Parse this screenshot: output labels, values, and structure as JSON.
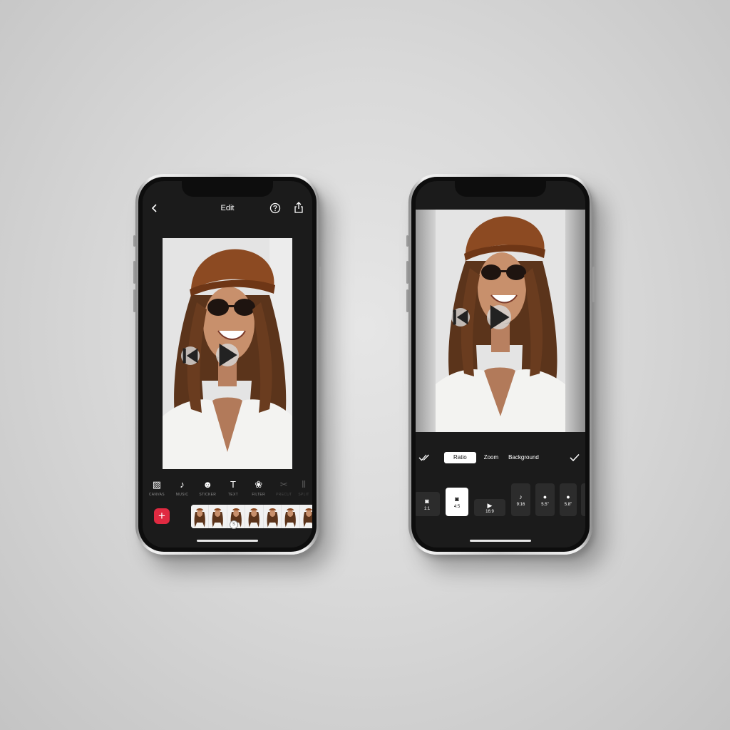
{
  "colors": {
    "accent_add": "#e02a41",
    "screen_bg": "#1b1b1b",
    "hat": "#8c4a22",
    "hair": "#5a3218"
  },
  "editor": {
    "title": "Edit",
    "back_icon": "chevron-left-icon",
    "help_icon": "question-circle-icon",
    "share_icon": "share-icon",
    "tools": [
      {
        "label": "CANVAS",
        "icon": "canvas-icon",
        "glyph": "▨"
      },
      {
        "label": "MUSIC",
        "icon": "music-note-icon",
        "glyph": "♪"
      },
      {
        "label": "STICKER",
        "icon": "smiley-icon",
        "glyph": "☻"
      },
      {
        "label": "TEXT",
        "icon": "text-icon",
        "glyph": "T"
      },
      {
        "label": "FILTER",
        "icon": "filter-icon",
        "glyph": "❀"
      },
      {
        "label": "PRECUT",
        "icon": "scissors-icon",
        "glyph": "✂"
      },
      {
        "label": "SPLIT",
        "icon": "split-icon",
        "glyph": "⫴"
      }
    ],
    "add_label": "+",
    "marker_label": "S"
  },
  "ratio_screen": {
    "tabs": [
      "Ratio",
      "Zoom",
      "Background"
    ],
    "active_tab": "Ratio",
    "ratios": [
      {
        "label": "1:1",
        "icon": "instagram-icon",
        "glyph": "◙"
      },
      {
        "label": "4:5",
        "icon": "instagram-icon",
        "glyph": "◙"
      },
      {
        "label": "16:9",
        "icon": "youtube-icon",
        "glyph": "▶"
      },
      {
        "label": "9:16",
        "icon": "tiktok-icon",
        "glyph": "♪"
      },
      {
        "label": "5.5\"",
        "icon": "apple-icon",
        "glyph": "●"
      },
      {
        "label": "5.8\"",
        "icon": "apple-icon",
        "glyph": "●"
      }
    ],
    "active_ratio": "4:5"
  }
}
